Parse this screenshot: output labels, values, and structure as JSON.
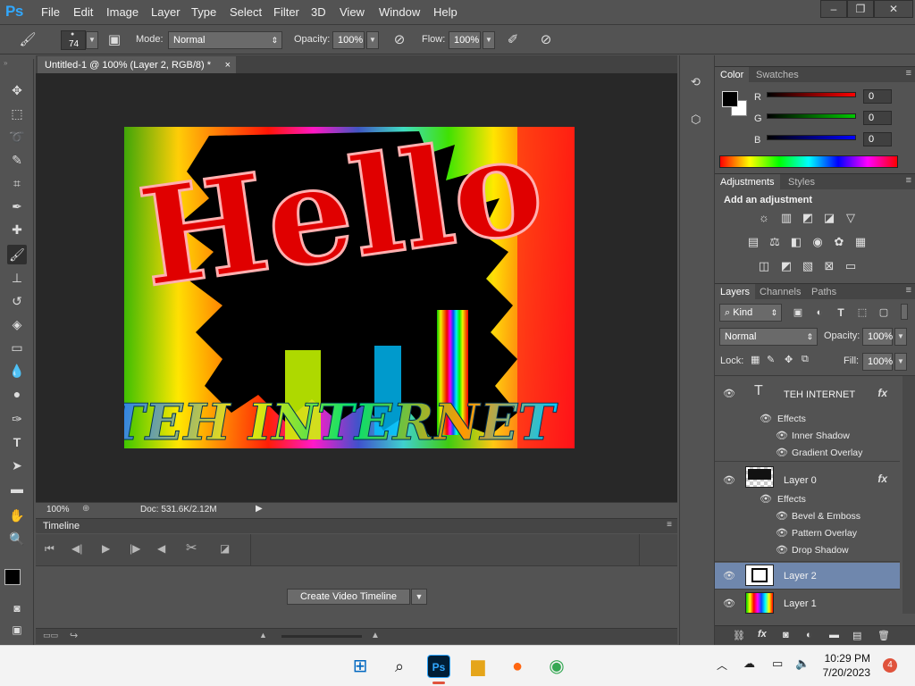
{
  "app": {
    "logo": "Ps"
  },
  "menu": [
    "File",
    "Edit",
    "Image",
    "Layer",
    "Type",
    "Select",
    "Filter",
    "3D",
    "View",
    "Window",
    "Help"
  ],
  "options": {
    "brush_size": "74",
    "mode_label": "Mode:",
    "mode_value": "Normal",
    "opacity_label": "Opacity:",
    "opacity_value": "100%",
    "flow_label": "Flow:",
    "flow_value": "100%"
  },
  "document": {
    "tab_title": "Untitled-1 @ 100% (Layer 2, RGB/8) *",
    "close": "×",
    "canvas_text_top": "Hello",
    "canvas_text_bottom": "TEH INTERNET"
  },
  "status": {
    "zoom": "100%",
    "doc": "Doc: 531.6K/2.12M"
  },
  "timeline": {
    "title": "Timeline",
    "create_button": "Create Video Timeline"
  },
  "color_panel": {
    "tabs": [
      "Color",
      "Swatches"
    ],
    "channels": [
      {
        "label": "R",
        "value": "0",
        "color": "#ff0000"
      },
      {
        "label": "G",
        "value": "0",
        "color": "#00c800"
      },
      {
        "label": "B",
        "value": "0",
        "color": "#0000ff"
      }
    ]
  },
  "adjustments_panel": {
    "tabs": [
      "Adjustments",
      "Styles"
    ],
    "heading": "Add an adjustment"
  },
  "layers_panel": {
    "tabs": [
      "Layers",
      "Channels",
      "Paths"
    ],
    "filter_kind": "Kind",
    "blend_mode": "Normal",
    "opacity_label": "Opacity:",
    "opacity_value": "100%",
    "lock_label": "Lock:",
    "fill_label": "Fill:",
    "fill_value": "100%",
    "layers": [
      {
        "name": "TEH INTERNET",
        "type": "text",
        "fx": "fx",
        "effects_label": "Effects",
        "effects": [
          "Inner Shadow",
          "Gradient Overlay"
        ]
      },
      {
        "name": "Layer 0",
        "type": "image",
        "fx": "fx",
        "effects_label": "Effects",
        "effects": [
          "Bevel & Emboss",
          "Pattern Overlay",
          "Drop Shadow"
        ]
      },
      {
        "name": "Layer 2",
        "type": "image",
        "selected": true
      },
      {
        "name": "Layer 1",
        "type": "image"
      }
    ]
  },
  "taskbar": {
    "time": "10:29 PM",
    "date": "7/20/2023",
    "notifications": "4"
  }
}
